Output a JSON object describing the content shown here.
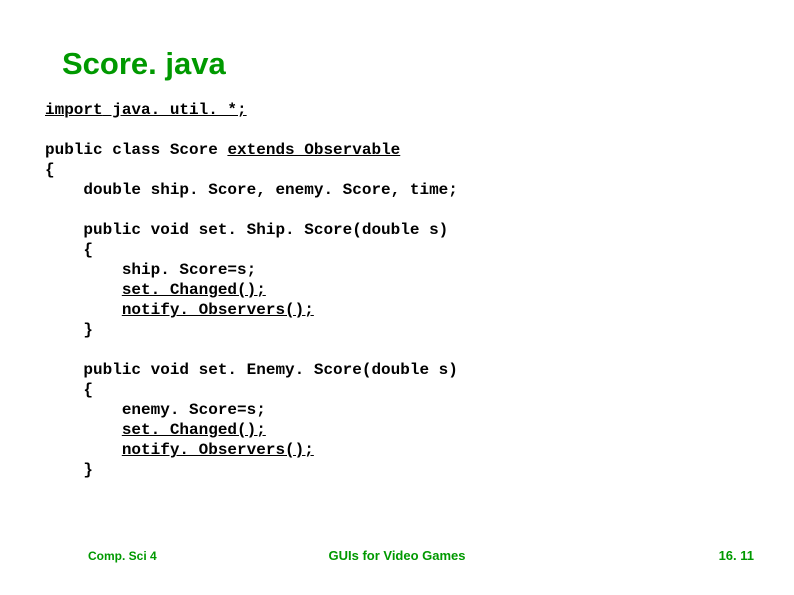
{
  "title": "Score. java",
  "code": {
    "l1a": "import",
    "l1b": " java. util. *;",
    "l2": "",
    "l3a": "public class Score ",
    "l3b": "extends Observable",
    "l4": "{",
    "l5": "    double ship. Score, enemy. Score, time;",
    "l6": "",
    "l7": "    public void set. Ship. Score(double s)",
    "l8": "    {",
    "l9": "        ship. Score=s;",
    "l10a": "        ",
    "l10b": "set. Changed();",
    "l11a": "        ",
    "l11b": "notify. Observers();",
    "l12": "    }",
    "l13": "",
    "l14": "    public void set. Enemy. Score(double s)",
    "l15": "    {",
    "l16": "        enemy. Score=s;",
    "l17a": "        ",
    "l17b": "set. Changed();",
    "l18a": "        ",
    "l18b": "notify. Observers();",
    "l19": "    }"
  },
  "footer": {
    "left": "Comp. Sci 4",
    "center": "GUIs for Video Games",
    "right": "16. 11"
  }
}
